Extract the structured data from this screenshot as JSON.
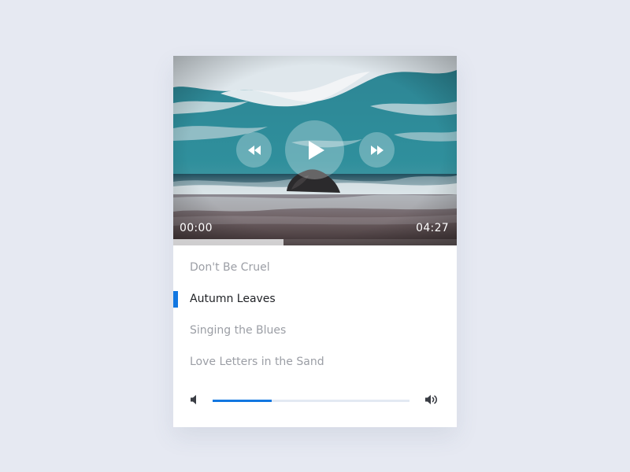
{
  "player": {
    "elapsed": "00:00",
    "duration": "04:27",
    "progress_fraction": 0.39
  },
  "playlist": [
    {
      "title": "Don't Be Cruel",
      "active": false
    },
    {
      "title": "Autumn Leaves",
      "active": true
    },
    {
      "title": "Singing the Blues",
      "active": false
    },
    {
      "title": "Love Letters in the Sand",
      "active": false
    }
  ],
  "volume": {
    "level_fraction": 0.3
  },
  "icons": {
    "rewind": "rewind-icon",
    "play": "play-icon",
    "forward": "fast-forward-icon",
    "volume_low": "volume-low-icon",
    "volume_high": "volume-high-icon"
  },
  "colors": {
    "background": "#e6e9f2",
    "accent": "#1277e1",
    "track_active": "#1f2125",
    "track_inactive": "#9b9ea5"
  }
}
